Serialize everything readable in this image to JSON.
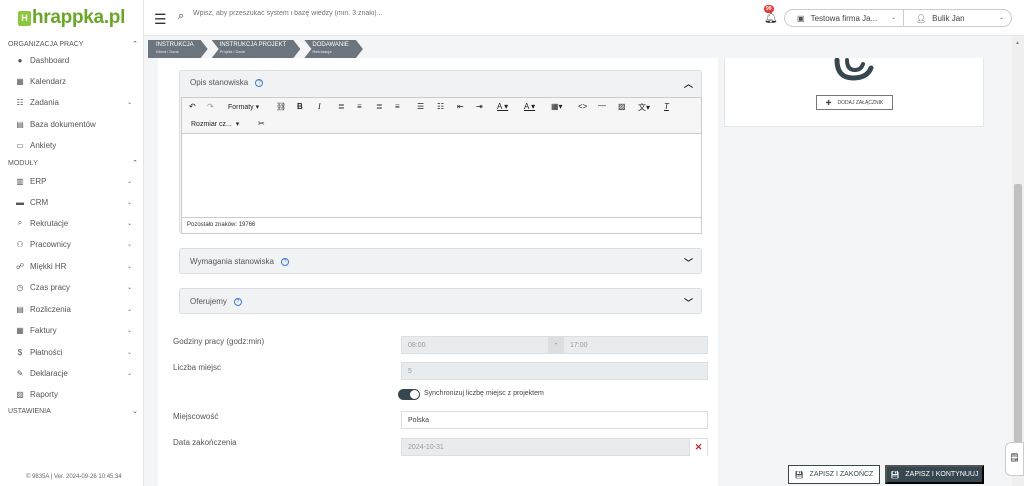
{
  "logo": {
    "mark": "H",
    "text": "hrappka.pl"
  },
  "sidebar": {
    "section_work": "ORGANIZACJA PRACY",
    "work_items": [
      {
        "label": "Dashboard",
        "icon": "●"
      },
      {
        "label": "Kalendarz",
        "icon": "▦"
      },
      {
        "label": "Zadania",
        "icon": "☷"
      },
      {
        "label": "Baza dokumentów",
        "icon": "▤"
      },
      {
        "label": "Ankiety",
        "icon": "▭"
      }
    ],
    "section_modules": "MODUŁY",
    "module_items": [
      {
        "label": "ERP",
        "icon": "▥"
      },
      {
        "label": "CRM",
        "icon": "▬"
      },
      {
        "label": "Rekrutacje",
        "icon": "⌕"
      },
      {
        "label": "Pracownicy",
        "icon": "⚇"
      },
      {
        "label": "Miękki HR",
        "icon": "☍"
      },
      {
        "label": "Czas pracy",
        "icon": "◷"
      },
      {
        "label": "Rozliczenia",
        "icon": "▤"
      },
      {
        "label": "Faktury",
        "icon": "▦"
      },
      {
        "label": "Płatności",
        "icon": "$"
      },
      {
        "label": "Deklaracje",
        "icon": "✎"
      },
      {
        "label": "Raporty",
        "icon": "▨"
      }
    ],
    "section_settings": "USTAWIENIA",
    "version": "© 9835A | Ver. 2024-09-26 10:45:34"
  },
  "topbar": {
    "search_placeholder": "Wpisz, aby przeszukać system i bazę wiedzy (min. 3 znaki)...",
    "notifications_count": "99",
    "company": "Testowa firma Ja...",
    "user": "Bulik Jan"
  },
  "breadcrumbs": [
    {
      "title": "INSTRUKCJA",
      "sub": "Klient / Dane"
    },
    {
      "title": "INSTRUKCJA PROJEKT",
      "sub": "Projekt / Dane"
    },
    {
      "title": "DODAWANIE",
      "sub": "Rekrutacja"
    }
  ],
  "form": {
    "desc_title": "Opis stanowiska",
    "help_mark": "?",
    "toolbar": {
      "formats": "Formaty",
      "font_size": "Rozmiar cz..."
    },
    "chars_left": "Pozostało znaków: 19766",
    "requirements_title": "Wymagania stanowiska",
    "offer_title": "Oferujemy",
    "hours_label": "Godziny pracy (godz:min)",
    "hours_from": "08:00",
    "hours_sep": "-",
    "hours_to": "17:00",
    "places_label": "Liczba miejsc",
    "places_value": "5",
    "sync_label": "Synchronizuj liczbę miejsc z projektem",
    "city_label": "Miejscowość",
    "city_value": "Polska",
    "end_date_label": "Data zakończenia",
    "end_date_value": "2024-10-31"
  },
  "attachments": {
    "add_label": "DODAJ ZAŁĄCZNIK"
  },
  "actions": {
    "save_close": "ZAPISZ I ZAKOŃCZ",
    "save_continue": "ZAPISZ I KONTYNUUJ"
  },
  "colors": {
    "brand": "#8dc63f",
    "dark": "#37474f",
    "danger": "#c62828",
    "help": "#3f7ad1"
  }
}
